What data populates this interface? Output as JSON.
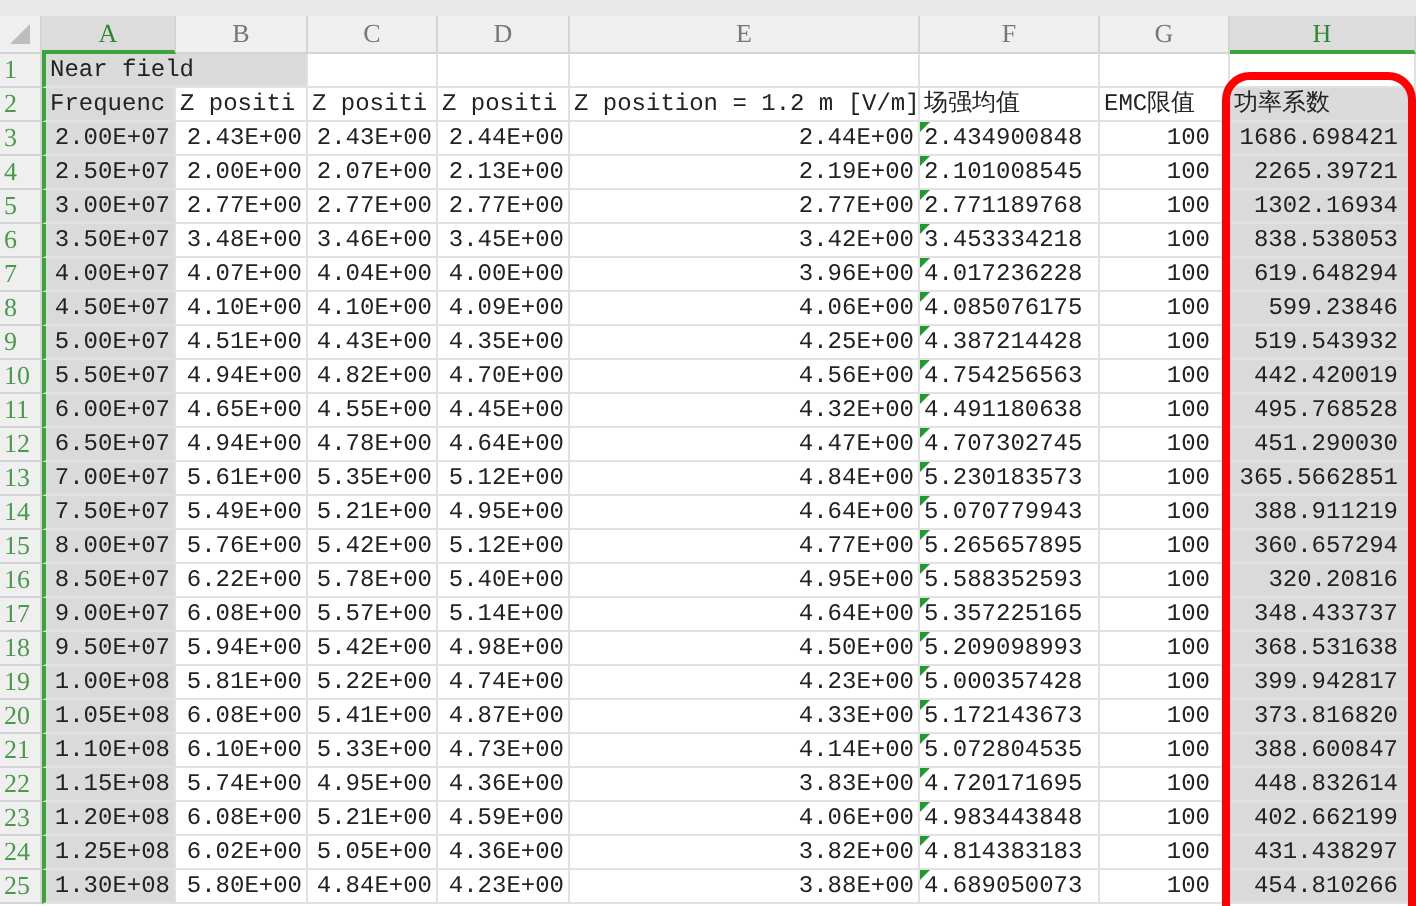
{
  "columns": [
    {
      "letter": "A",
      "selected": true
    },
    {
      "letter": "B",
      "selected": false
    },
    {
      "letter": "C",
      "selected": false
    },
    {
      "letter": "D",
      "selected": false
    },
    {
      "letter": "E",
      "selected": false
    },
    {
      "letter": "F",
      "selected": false,
      "text_number_marker": true
    },
    {
      "letter": "G",
      "selected": false
    },
    {
      "letter": "H",
      "selected": true,
      "highlighted": true
    }
  ],
  "rows": [
    {
      "number": "1",
      "kind": "title",
      "cells": [
        "Near field"
      ]
    },
    {
      "number": "2",
      "kind": "header",
      "cells": [
        "Frequenc",
        "Z positi",
        "Z positi",
        "Z positi",
        "Z position = 1.2 m [V/m]",
        "场强均值",
        "EMC限值",
        "功率系数"
      ]
    },
    {
      "number": "3",
      "kind": "data",
      "cells": [
        "2.00E+07",
        "2.43E+00",
        "2.43E+00",
        "2.44E+00",
        "2.44E+00",
        "2.434900848",
        "100",
        "1686.698421"
      ]
    },
    {
      "number": "4",
      "kind": "data",
      "cells": [
        "2.50E+07",
        "2.00E+00",
        "2.07E+00",
        "2.13E+00",
        "2.19E+00",
        "2.101008545",
        "100",
        "2265.39721"
      ]
    },
    {
      "number": "5",
      "kind": "data",
      "cells": [
        "3.00E+07",
        "2.77E+00",
        "2.77E+00",
        "2.77E+00",
        "2.77E+00",
        "2.771189768",
        "100",
        "1302.16934"
      ]
    },
    {
      "number": "6",
      "kind": "data",
      "cells": [
        "3.50E+07",
        "3.48E+00",
        "3.46E+00",
        "3.45E+00",
        "3.42E+00",
        "3.453334218",
        "100",
        "838.538053"
      ]
    },
    {
      "number": "7",
      "kind": "data",
      "cells": [
        "4.00E+07",
        "4.07E+00",
        "4.04E+00",
        "4.00E+00",
        "3.96E+00",
        "4.017236228",
        "100",
        "619.648294"
      ]
    },
    {
      "number": "8",
      "kind": "data",
      "cells": [
        "4.50E+07",
        "4.10E+00",
        "4.10E+00",
        "4.09E+00",
        "4.06E+00",
        "4.085076175",
        "100",
        "599.23846"
      ]
    },
    {
      "number": "9",
      "kind": "data",
      "cells": [
        "5.00E+07",
        "4.51E+00",
        "4.43E+00",
        "4.35E+00",
        "4.25E+00",
        "4.387214428",
        "100",
        "519.543932"
      ]
    },
    {
      "number": "10",
      "kind": "data",
      "cells": [
        "5.50E+07",
        "4.94E+00",
        "4.82E+00",
        "4.70E+00",
        "4.56E+00",
        "4.754256563",
        "100",
        "442.420019"
      ]
    },
    {
      "number": "11",
      "kind": "data",
      "cells": [
        "6.00E+07",
        "4.65E+00",
        "4.55E+00",
        "4.45E+00",
        "4.32E+00",
        "4.491180638",
        "100",
        "495.768528"
      ]
    },
    {
      "number": "12",
      "kind": "data",
      "cells": [
        "6.50E+07",
        "4.94E+00",
        "4.78E+00",
        "4.64E+00",
        "4.47E+00",
        "4.707302745",
        "100",
        "451.290030"
      ]
    },
    {
      "number": "13",
      "kind": "data",
      "cells": [
        "7.00E+07",
        "5.61E+00",
        "5.35E+00",
        "5.12E+00",
        "4.84E+00",
        "5.230183573",
        "100",
        "365.5662851"
      ]
    },
    {
      "number": "14",
      "kind": "data",
      "cells": [
        "7.50E+07",
        "5.49E+00",
        "5.21E+00",
        "4.95E+00",
        "4.64E+00",
        "5.070779943",
        "100",
        "388.911219"
      ]
    },
    {
      "number": "15",
      "kind": "data",
      "cells": [
        "8.00E+07",
        "5.76E+00",
        "5.42E+00",
        "5.12E+00",
        "4.77E+00",
        "5.265657895",
        "100",
        "360.657294"
      ]
    },
    {
      "number": "16",
      "kind": "data",
      "cells": [
        "8.50E+07",
        "6.22E+00",
        "5.78E+00",
        "5.40E+00",
        "4.95E+00",
        "5.588352593",
        "100",
        "320.20816"
      ]
    },
    {
      "number": "17",
      "kind": "data",
      "cells": [
        "9.00E+07",
        "6.08E+00",
        "5.57E+00",
        "5.14E+00",
        "4.64E+00",
        "5.357225165",
        "100",
        "348.433737"
      ]
    },
    {
      "number": "18",
      "kind": "data",
      "cells": [
        "9.50E+07",
        "5.94E+00",
        "5.42E+00",
        "4.98E+00",
        "4.50E+00",
        "5.209098993",
        "100",
        "368.531638"
      ]
    },
    {
      "number": "19",
      "kind": "data",
      "cells": [
        "1.00E+08",
        "5.81E+00",
        "5.22E+00",
        "4.74E+00",
        "4.23E+00",
        "5.000357428",
        "100",
        "399.942817"
      ]
    },
    {
      "number": "20",
      "kind": "data",
      "cells": [
        "1.05E+08",
        "6.08E+00",
        "5.41E+00",
        "4.87E+00",
        "4.33E+00",
        "5.172143673",
        "100",
        "373.816820"
      ]
    },
    {
      "number": "21",
      "kind": "data",
      "cells": [
        "1.10E+08",
        "6.10E+00",
        "5.33E+00",
        "4.73E+00",
        "4.14E+00",
        "5.072804535",
        "100",
        "388.600847"
      ]
    },
    {
      "number": "22",
      "kind": "data",
      "cells": [
        "1.15E+08",
        "5.74E+00",
        "4.95E+00",
        "4.36E+00",
        "3.83E+00",
        "4.720171695",
        "100",
        "448.832614"
      ]
    },
    {
      "number": "23",
      "kind": "data",
      "cells": [
        "1.20E+08",
        "6.08E+00",
        "5.21E+00",
        "4.59E+00",
        "4.06E+00",
        "4.983443848",
        "100",
        "402.662199"
      ]
    },
    {
      "number": "24",
      "kind": "data",
      "cells": [
        "1.25E+08",
        "6.02E+00",
        "5.05E+00",
        "4.36E+00",
        "3.82E+00",
        "4.814383183",
        "100",
        "431.438297"
      ]
    },
    {
      "number": "25",
      "kind": "data",
      "cells": [
        "1.30E+08",
        "5.80E+00",
        "4.84E+00",
        "4.23E+00",
        "3.88E+00",
        "4.689050073",
        "100",
        "454.810266"
      ]
    }
  ]
}
